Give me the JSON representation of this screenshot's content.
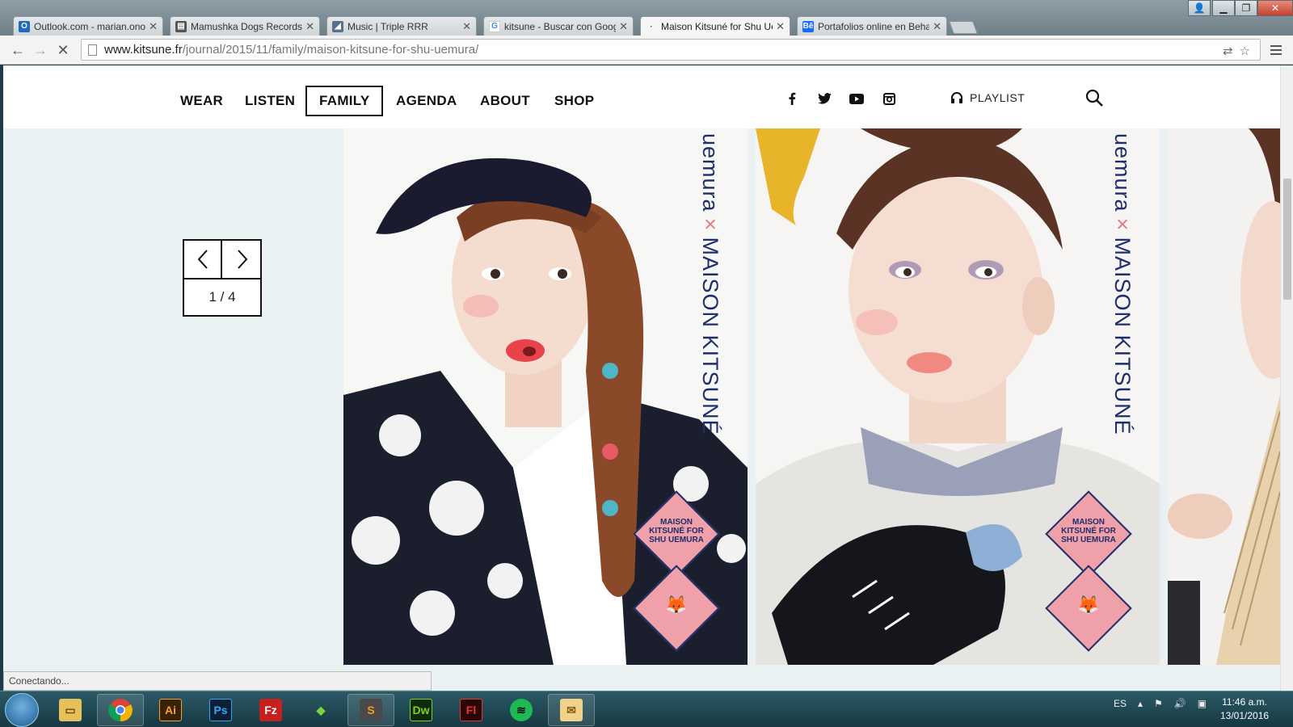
{
  "browser": {
    "tabs": [
      {
        "label": "Outlook.com - marian.ono",
        "icon": "outlook-icon",
        "color": "#1e6bb8",
        "glyph": "O"
      },
      {
        "label": "Mamushka Dogs Records",
        "icon": "page-icon",
        "color": "#555555",
        "glyph": "▤"
      },
      {
        "label": "Music | Triple RRR",
        "icon": "music-icon",
        "color": "#5b6f8a",
        "glyph": "◢"
      },
      {
        "label": "kitsune - Buscar con Goog",
        "icon": "google-icon",
        "color": "#ffffff",
        "glyph": "G"
      },
      {
        "label": "Maison Kitsuné for Shu Ue",
        "icon": "loading-icon",
        "color": "#dddddd",
        "glyph": "·"
      },
      {
        "label": "Portafolios online en Beha",
        "icon": "behance-icon",
        "color": "#1769ff",
        "glyph": "Bē"
      }
    ],
    "url_host": "www.kitsune.fr",
    "url_path": "/journal/2015/11/family/maison-kitsune-for-shu-uemura/",
    "status": "Conectando..."
  },
  "site": {
    "nav": [
      "WEAR",
      "LISTEN",
      "FAMILY",
      "AGENDA",
      "ABOUT",
      "SHOP"
    ],
    "playlist_label": "PLAYLIST",
    "pager": "1 / 4"
  },
  "slides": {
    "brand_top": "uemura",
    "brand_x": "×",
    "brand_bottom": "MAISON KITSUNÉ",
    "badge": "MAISON KITSUNÉ FOR SHU UEMURA"
  },
  "taskbar": {
    "lang": "ES",
    "time": "11:46 a.m.",
    "date": "13/01/2016"
  },
  "colors": {
    "accent_navy": "#1d2e6b",
    "accent_pink": "#f0a0a8",
    "panel_bg": "#e9f1f2"
  }
}
